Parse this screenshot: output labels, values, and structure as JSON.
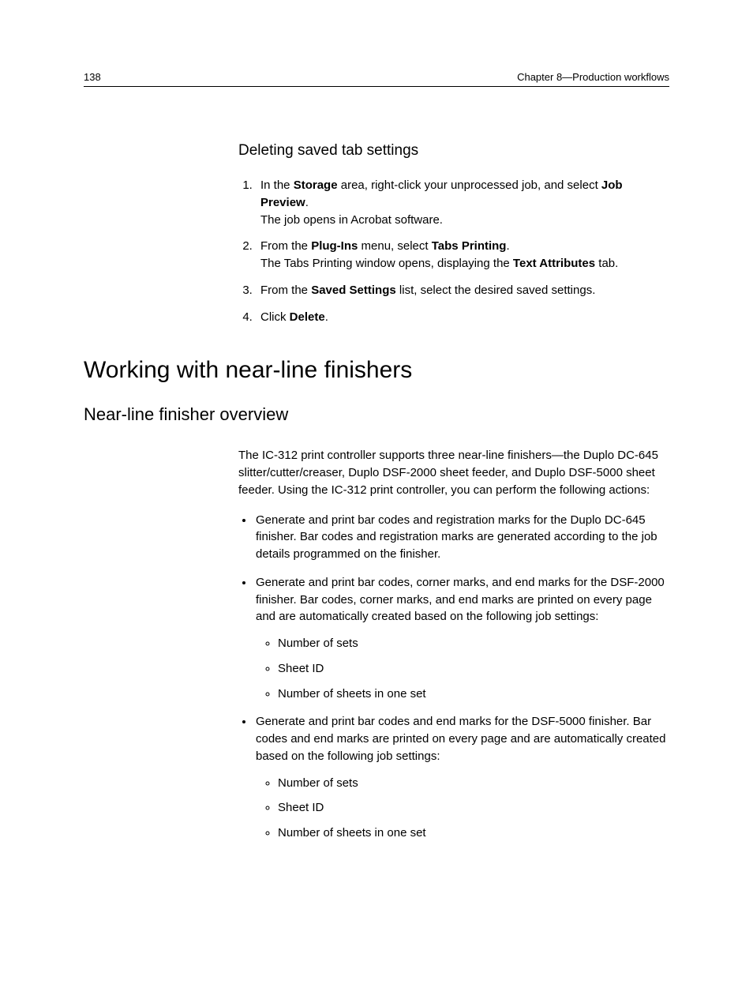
{
  "header": {
    "page_number": "138",
    "chapter": "Chapter 8—Production workflows"
  },
  "deleting": {
    "title": "Deleting saved tab settings",
    "steps": {
      "s1_a": "In the ",
      "s1_b": "Storage",
      "s1_c": " area, right-click your unprocessed job, and select ",
      "s1_d": "Job Preview",
      "s1_e": ".",
      "s1_f": "The job opens in Acrobat software.",
      "s2_a": "From the ",
      "s2_b": "Plug-Ins",
      "s2_c": " menu, select ",
      "s2_d": "Tabs Printing",
      "s2_e": ".",
      "s2_f": "The Tabs Printing window opens, displaying the ",
      "s2_g": "Text Attributes",
      "s2_h": " tab.",
      "s3_a": "From the ",
      "s3_b": "Saved Settings",
      "s3_c": " list, select the desired saved settings.",
      "s4_a": "Click ",
      "s4_b": "Delete",
      "s4_c": "."
    }
  },
  "section": {
    "title": "Working with near-line finishers"
  },
  "overview": {
    "title": "Near-line finisher overview",
    "intro": "The IC-312 print controller supports three near-line finishers—the Duplo DC-645 slitter/cutter/creaser, Duplo DSF-2000 sheet feeder, and Duplo DSF-5000 sheet feeder. Using the IC-312 print controller, you can perform the following actions:",
    "b1": "Generate and print bar codes and registration marks for the Duplo DC-645 finisher. Bar codes and registration marks are generated according to the job details programmed on the finisher.",
    "b2": "Generate and print bar codes, corner marks, and end marks for the DSF-2000 finisher. Bar codes, corner marks, and end marks are printed on every page and are automatically created based on the following job settings:",
    "b2_sub1": "Number of sets",
    "b2_sub2": "Sheet ID",
    "b2_sub3": "Number of sheets in one set",
    "b3": "Generate and print bar codes and end marks for the DSF-5000 finisher. Bar codes and end marks are printed on every page and are automatically created based on the following job settings:",
    "b3_sub1": "Number of sets",
    "b3_sub2": "Sheet ID",
    "b3_sub3": "Number of sheets in one set"
  }
}
